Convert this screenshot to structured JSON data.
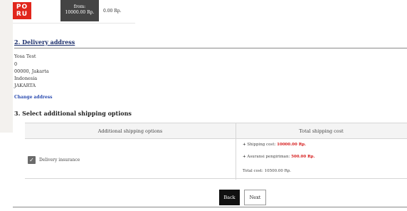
{
  "carrier": {
    "logo_top": "PO",
    "logo_bottom": "RU",
    "from_label": "from:",
    "from_price": "10000.00 Rp.",
    "extra_price": "0.00 Rp."
  },
  "delivery": {
    "title": "2. Delivery address",
    "name": "Yosa Test",
    "line1": "0",
    "city": "00000, Jakarta",
    "country": "Indonesia",
    "region": "JAKARTA",
    "change_link": "Change address"
  },
  "shipping": {
    "title": "3. Select additional shipping options",
    "col_options": "Additional shipping options",
    "col_cost": "Total shipping cost",
    "option_label": "Delivery insurance",
    "option_checked": true,
    "shipping_cost_label": "Shipping cost: ",
    "shipping_cost_value": "10000.00 Rp.",
    "insurance_label": "Asuransi pengiriman: ",
    "insurance_value": "500.00 Rp.",
    "total_label": "Total cost: 10500.00 Rp."
  },
  "buttons": {
    "back": "Back",
    "next": "Next"
  }
}
